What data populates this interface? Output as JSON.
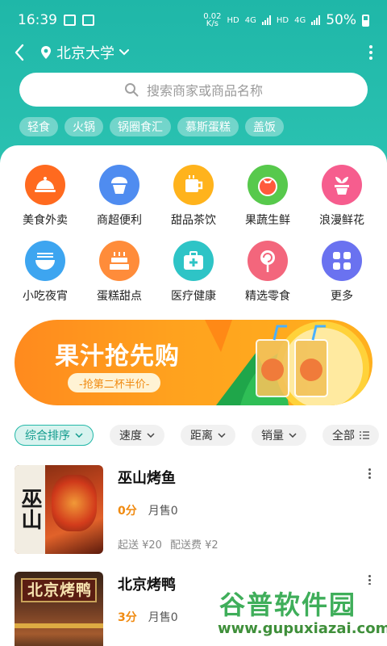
{
  "status_bar": {
    "time": "16:39",
    "net_speed": "0.02\nK/s",
    "hd1": "HD",
    "net1": "4G",
    "hd2": "HD",
    "net2": "4G",
    "battery": "50%"
  },
  "nav": {
    "location": "北京大学"
  },
  "search": {
    "placeholder": "搜索商家或商品名称"
  },
  "quick_tags": [
    "轻食",
    "火锅",
    "锅圈食汇",
    "慕斯蛋糕",
    "盖饭"
  ],
  "categories": [
    {
      "label": "美食外卖",
      "icon": "food-cloche-icon",
      "color": "#ff6a1f"
    },
    {
      "label": "商超便利",
      "icon": "cupcake-icon",
      "color": "#4f8cf0"
    },
    {
      "label": "甜品茶饮",
      "icon": "cup-icon",
      "color": "#ffb31c"
    },
    {
      "label": "果蔬生鲜",
      "icon": "tomato-icon",
      "color": "#57c94c"
    },
    {
      "label": "浪漫鲜花",
      "icon": "flower-pot-icon",
      "color": "#f65d8e"
    },
    {
      "label": "小吃夜宵",
      "icon": "noodle-bowl-icon",
      "color": "#3da5f0"
    },
    {
      "label": "蛋糕甜点",
      "icon": "cake-icon",
      "color": "#ff8c3a"
    },
    {
      "label": "医疗健康",
      "icon": "medical-kit-icon",
      "color": "#2ec4c6"
    },
    {
      "label": "精选零食",
      "icon": "lollipop-icon",
      "color": "#f3667c"
    },
    {
      "label": "更多",
      "icon": "grid-more-icon",
      "color": "#6a72f0"
    }
  ],
  "banner": {
    "title": "果汁抢先购",
    "subtitle": "-抢第二杯半价-",
    "accent": "#ff9a1e"
  },
  "filters": [
    {
      "label": "综合排序",
      "active": true
    },
    {
      "label": "速度",
      "active": false
    },
    {
      "label": "距离",
      "active": false
    },
    {
      "label": "销量",
      "active": false
    },
    {
      "label": "全部",
      "active": false
    }
  ],
  "shops": [
    {
      "name": "巫山烤鱼",
      "score": "0分",
      "sales": "月售0",
      "min_order": "起送 ¥20",
      "delivery_fee": "配送费 ¥2",
      "thumb_text": "巫山"
    },
    {
      "name": "北京烤鸭",
      "score": "3分",
      "sales": "月售0",
      "thumb_text": "北京烤鸭"
    }
  ],
  "watermark": {
    "title": "谷普软件园",
    "url": "www.gupuxiazai.com"
  }
}
